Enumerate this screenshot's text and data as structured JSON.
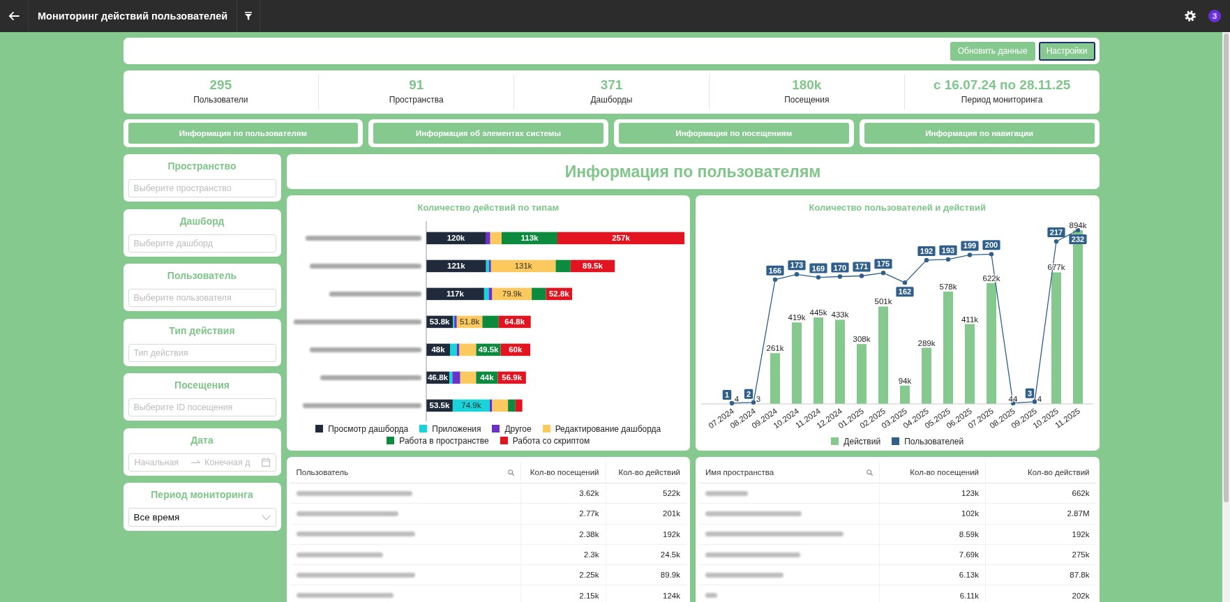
{
  "app_bar": {
    "title": "Мониторинг действий пользователей",
    "avatar": "З"
  },
  "toolbar": {
    "buttons": [
      {
        "label": "Обновить данные",
        "focused": false
      },
      {
        "label": "Настройки",
        "focused": true
      }
    ]
  },
  "kpis": [
    {
      "value": "295",
      "label": "Пользователи"
    },
    {
      "value": "91",
      "label": "Пространства"
    },
    {
      "value": "371",
      "label": "Дашборды"
    },
    {
      "value": "180k",
      "label": "Посещения"
    },
    {
      "value": "с 16.07.24 по 28.11.25",
      "label": "Период мониторинга"
    }
  ],
  "sections": [
    {
      "label": "Информация по пользователям"
    },
    {
      "label": "Информация об элементах системы"
    },
    {
      "label": "Информация по посещениям"
    },
    {
      "label": "Информация по навигации"
    }
  ],
  "filters": [
    {
      "title": "Пространство",
      "kind": "select",
      "placeholder": "Выберите пространство"
    },
    {
      "title": "Дашборд",
      "kind": "select",
      "placeholder": "Выберите дашборд"
    },
    {
      "title": "Пользователь",
      "kind": "select",
      "placeholder": "Выберите пользователя"
    },
    {
      "title": "Тип действия",
      "kind": "select",
      "placeholder": "Тип действия"
    },
    {
      "title": "Посещения",
      "kind": "select",
      "placeholder": "Выберите ID посещения"
    },
    {
      "title": "Дата",
      "kind": "daterange",
      "placeholders": [
        "Начальная",
        "Конечная д"
      ]
    },
    {
      "title": "Период мониторинга",
      "kind": "dropdown",
      "value": "Все время"
    }
  ],
  "section_title": "Информация по пользователям",
  "actions_chart": {
    "chart_data": {
      "type": "bar",
      "orientation": "horizontal",
      "stacked": true,
      "title": "Количество действий по типам",
      "series": [
        {
          "name": "Просмотр дашборда",
          "color": "#1f2a3a",
          "values": [
            120,
            121,
            117,
            53.8,
            48,
            46.8,
            53.5
          ],
          "value_labels": [
            "120k",
            "121k",
            "117k",
            "53.8k",
            "48k",
            "46.8k",
            "53.5k"
          ]
        },
        {
          "name": "Приложения",
          "color": "#19d3da",
          "values": [
            0,
            6,
            9.5,
            3,
            14,
            6,
            74.9
          ],
          "value_labels": [
            null,
            null,
            null,
            null,
            null,
            null,
            "74.9k"
          ]
        },
        {
          "name": "Другое",
          "color": "#6a30c9",
          "values": [
            9.5,
            4,
            7,
            5,
            5,
            16,
            5
          ],
          "value_labels": [
            null,
            null,
            null,
            null,
            null,
            null,
            null
          ]
        },
        {
          "name": "Редактирование дашборда",
          "color": "#fbc95d",
          "values": [
            23,
            131,
            79.9,
            51.8,
            34,
            32,
            32
          ],
          "value_labels": [
            null,
            "131k",
            "79.9k",
            "51.8k",
            null,
            null,
            null
          ]
        },
        {
          "name": "Работа в пространстве",
          "color": "#0c8a3e",
          "values": [
            113,
            30,
            29,
            33,
            49.5,
            44,
            15
          ],
          "value_labels": [
            "113k",
            null,
            null,
            null,
            "49.5k",
            "44k",
            null
          ]
        },
        {
          "name": "Работа со скриптом",
          "color": "#e3131f",
          "values": [
            257,
            89.5,
            52.8,
            64.8,
            60,
            56.9,
            14
          ],
          "value_labels": [
            "257k",
            "89.5k",
            "52.8k",
            "64.8k",
            "60k",
            "56.9k",
            null
          ]
        }
      ]
    }
  },
  "users_chart": {
    "chart_data": {
      "type": "bar",
      "title": "Количество пользователей и действий",
      "categories": [
        "07.2024",
        "08.2024",
        "09.2024",
        "10.2024",
        "11.2024",
        "12.2024",
        "01.2025",
        "02.2025",
        "03.2025",
        "04.2025",
        "05.2025",
        "06.2025",
        "07.2025",
        "08.2025",
        "09.2025",
        "10.2025",
        "11.2025"
      ],
      "series": [
        {
          "name": "Действий",
          "type": "bar",
          "color": "#86c98f",
          "values": [
            4,
            3,
            261000,
            419000,
            445000,
            433000,
            308000,
            501000,
            94000,
            289000,
            578000,
            411000,
            622000,
            44,
            4,
            677000,
            894000
          ],
          "value_labels": [
            "4",
            "3",
            "261k",
            "419k",
            "445k",
            "433k",
            "308k",
            "501k",
            "94k",
            "289k",
            "578k",
            "411k",
            "622k",
            "44",
            "4",
            "677k",
            "894k"
          ]
        },
        {
          "name": "Пользователей",
          "type": "line",
          "axis": "y2",
          "marker": "circle",
          "color": "#2f5f8a",
          "values": [
            1,
            2,
            166,
            173,
            169,
            170,
            171,
            175,
            162,
            192,
            193,
            199,
            200,
            1,
            3,
            217,
            232
          ],
          "value_labels": [
            "1",
            "2",
            "166",
            "173",
            "169",
            "170",
            "171",
            "175",
            "162",
            "192",
            "193",
            "199",
            "200",
            null,
            "3",
            "217",
            "232"
          ]
        }
      ]
    }
  },
  "users_table": {
    "columns": [
      {
        "label": "Пользователь",
        "searchable": true
      },
      {
        "label": "Кол-во посещений",
        "searchable": false
      },
      {
        "label": "Кол-во действий",
        "searchable": false
      }
    ],
    "rows": [
      {
        "visits": "3.62k",
        "actions": "522k"
      },
      {
        "visits": "2.77k",
        "actions": "201k"
      },
      {
        "visits": "2.38k",
        "actions": "192k"
      },
      {
        "visits": "2.3k",
        "actions": "24.5k"
      },
      {
        "visits": "2.25k",
        "actions": "89.9k"
      },
      {
        "visits": "2.15k",
        "actions": "124k"
      }
    ]
  },
  "spaces_table": {
    "columns": [
      {
        "label": "Имя пространства",
        "searchable": true
      },
      {
        "label": "Кол-во посещений",
        "searchable": false
      },
      {
        "label": "Кол-во действий",
        "searchable": false
      }
    ],
    "rows": [
      {
        "visits": "123k",
        "actions": "662k"
      },
      {
        "visits": "102k",
        "actions": "2.87M"
      },
      {
        "visits": "8.59k",
        "actions": "192k"
      },
      {
        "visits": "7.69k",
        "actions": "275k"
      },
      {
        "visits": "6.13k",
        "actions": "87.8k"
      },
      {
        "visits": "6.11k",
        "actions": "202k"
      }
    ]
  }
}
